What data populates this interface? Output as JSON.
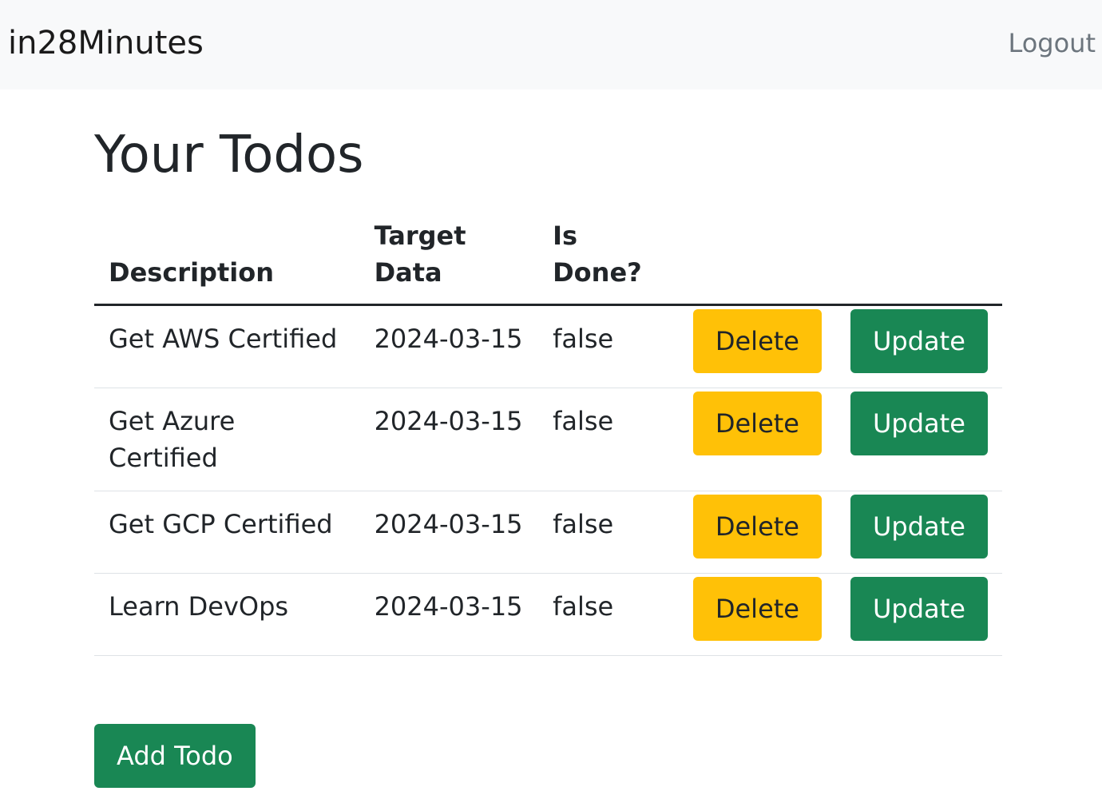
{
  "navbar": {
    "brand": "in28Minutes",
    "logout": "Logout"
  },
  "page": {
    "title": "Your Todos"
  },
  "table": {
    "headers": {
      "description": "Description",
      "target_date": "Target Data",
      "is_done": "Is Done?"
    },
    "rows": [
      {
        "description": "Get AWS Certified",
        "target_date": "2024-03-15",
        "done": "false",
        "delete": "Delete",
        "update": "Update"
      },
      {
        "description": "Get Azure Certified",
        "target_date": "2024-03-15",
        "done": "false",
        "delete": "Delete",
        "update": "Update"
      },
      {
        "description": "Get GCP Certified",
        "target_date": "2024-03-15",
        "done": "false",
        "delete": "Delete",
        "update": "Update"
      },
      {
        "description": "Learn DevOps",
        "target_date": "2024-03-15",
        "done": "false",
        "delete": "Delete",
        "update": "Update"
      }
    ]
  },
  "actions": {
    "add_todo": "Add Todo"
  },
  "colors": {
    "navbar_bg": "#f8f9fa",
    "warning": "#ffc107",
    "success": "#198754"
  }
}
